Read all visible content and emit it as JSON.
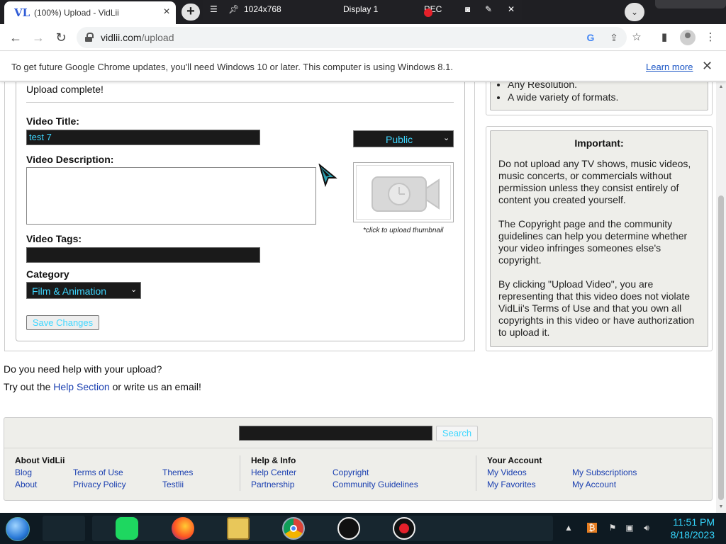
{
  "browser": {
    "tab_title": "(100%) Upload - VidLii",
    "tab_favicon": "VL",
    "new_tab": "+",
    "recorder": {
      "resolution": "1024x768",
      "display": "Display 1",
      "rec": "REC"
    },
    "url_host": "vidlii.com",
    "url_path": "/upload",
    "google_glyph": "G"
  },
  "infobar": {
    "message": "To get future Google Chrome updates, you'll need Windows 10 or later. This computer is using Windows 8.1.",
    "link": "Learn more"
  },
  "upload": {
    "status": "Upload complete!",
    "title_label": "Video Title:",
    "title_value": "test 7",
    "privacy": "Public",
    "description_label": "Video Description:",
    "description_value": "",
    "tags_label": "Video Tags:",
    "tags_value": "",
    "category_label": "Category",
    "category": "Film & Animation",
    "thumbnail_caption": "*click to upload thumbnail",
    "save_button": "Save Changes"
  },
  "sidebar": {
    "features": [
      "Any Resolution.",
      "A wide variety of formats."
    ],
    "important_title": "Important:",
    "important_paragraphs": [
      "Do not upload any TV shows, music videos, music concerts, or commercials without permission unless they consist entirely of content you created yourself.",
      "The Copyright page and the community guidelines can help you determine whether your video infringes someones else's copyright.",
      "By clicking \"Upload Video\", you are representing that this video does not violate VidLii's Terms of Use and that you own all copyrights in this video or have authorization to upload it."
    ]
  },
  "help": {
    "question": "Do you need help with your upload?",
    "prefix": "Try out the ",
    "link": "Help Section",
    "suffix": " or write us an email!"
  },
  "footer": {
    "search_value": "",
    "search_button": "Search",
    "columns": [
      {
        "title": "About VidLii",
        "links": [
          "Blog",
          "Terms of Use",
          "Themes",
          "About",
          "Privacy Policy",
          "Testlii"
        ]
      },
      {
        "title": "Help & Info",
        "links": [
          "Help Center",
          "Copyright",
          "Partnership",
          "Community Guidelines"
        ]
      },
      {
        "title": "Your Account",
        "links": [
          "My Videos",
          "My Subscriptions",
          "My Favorites",
          "My Account"
        ]
      }
    ]
  },
  "taskbar": {
    "time": "11:51 PM",
    "date": "8/18/2023"
  },
  "colors": {
    "accent_cyan": "#3fd7ff",
    "link_blue": "#1a3fb0",
    "panel_bg": "#eeeeea",
    "dark_field": "#1a1a1a"
  }
}
